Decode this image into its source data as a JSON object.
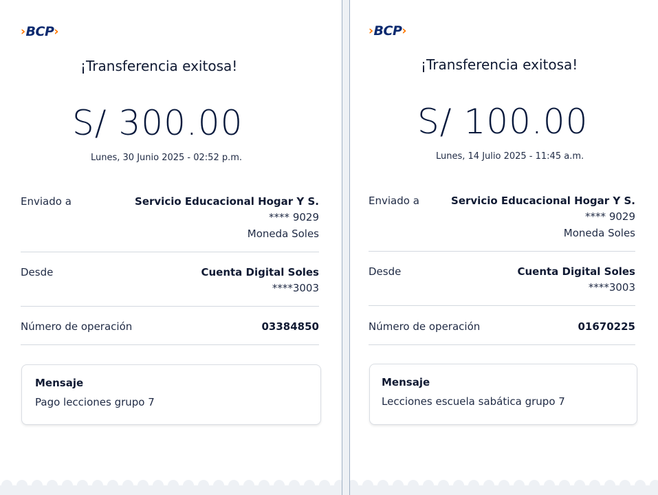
{
  "receipts": [
    {
      "brand": "BCP",
      "title": "¡Transferencia exitosa!",
      "amount": "S/ 300.00",
      "datetime": "Lunes, 30 Junio 2025 - 02:52 p.m.",
      "sent_to": {
        "label": "Enviado a",
        "name": "Servicio Educacional Hogar Y S.",
        "account": "**** 9029",
        "currency": "Moneda Soles"
      },
      "from": {
        "label": "Desde",
        "account_name": "Cuenta Digital Soles",
        "account_number": "****3003"
      },
      "operation": {
        "label": "Número de operación",
        "number": "03384850"
      },
      "message": {
        "label": "Mensaje",
        "text": "Pago lecciones grupo 7"
      }
    },
    {
      "brand": "BCP",
      "title": "¡Transferencia exitosa!",
      "amount": "S/ 100.00",
      "datetime": "Lunes, 14 Julio 2025 - 11:45 a.m.",
      "sent_to": {
        "label": "Enviado a",
        "name": "Servicio Educacional Hogar Y S.",
        "account": "**** 9029",
        "currency": "Moneda Soles"
      },
      "from": {
        "label": "Desde",
        "account_name": "Cuenta Digital Soles",
        "account_number": "****3003"
      },
      "operation": {
        "label": "Número de operación",
        "number": "01670225"
      },
      "message": {
        "label": "Mensaje",
        "text": "Lecciones escuela sabática grupo 7"
      }
    }
  ],
  "colors": {
    "brand_blue": "#0b2a6f",
    "brand_orange": "#ff7800",
    "text_dark": "#101a33",
    "divider": "#d3d8df"
  }
}
